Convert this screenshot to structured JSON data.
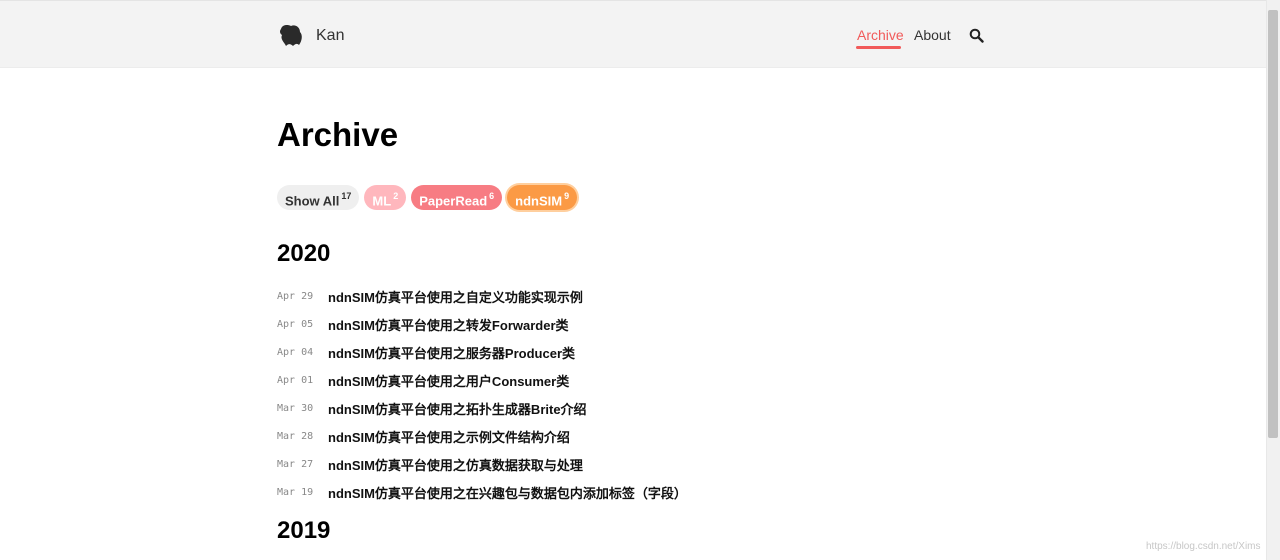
{
  "header": {
    "site_title": "Kan",
    "nav": {
      "archive": "Archive",
      "about": "About"
    },
    "icons": {
      "logo": "animal-head-logo-icon",
      "search": "search-icon"
    }
  },
  "colors": {
    "accent": "#f15a5a",
    "tag_ml": "#ffb7bd",
    "tag_paperread": "#f77c83",
    "tag_ndnsim": "#fb9a45"
  },
  "page": {
    "title": "Archive"
  },
  "tags": [
    {
      "label": "Show All",
      "count": "17"
    },
    {
      "label": "ML",
      "count": "2"
    },
    {
      "label": "PaperRead",
      "count": "6"
    },
    {
      "label": "ndnSIM",
      "count": "9"
    }
  ],
  "years": [
    "2020",
    "2019"
  ],
  "posts": [
    {
      "date": "Apr 29",
      "title": "ndnSIM仿真平台使用之自定义功能实现示例"
    },
    {
      "date": "Apr 05",
      "title": "ndnSIM仿真平台使用之转发Forwarder类"
    },
    {
      "date": "Apr 04",
      "title": "ndnSIM仿真平台使用之服务器Producer类"
    },
    {
      "date": "Apr 01",
      "title": "ndnSIM仿真平台使用之用户Consumer类"
    },
    {
      "date": "Mar 30",
      "title": "ndnSIM仿真平台使用之拓扑生成器Brite介绍"
    },
    {
      "date": "Mar 28",
      "title": "ndnSIM仿真平台使用之示例文件结构介绍"
    },
    {
      "date": "Mar 27",
      "title": "ndnSIM仿真平台使用之仿真数据获取与处理"
    },
    {
      "date": "Mar 19",
      "title": "ndnSIM仿真平台使用之在兴趣包与数据包内添加标签（字段）"
    }
  ],
  "watermark": "https://blog.csdn.net/Xims"
}
